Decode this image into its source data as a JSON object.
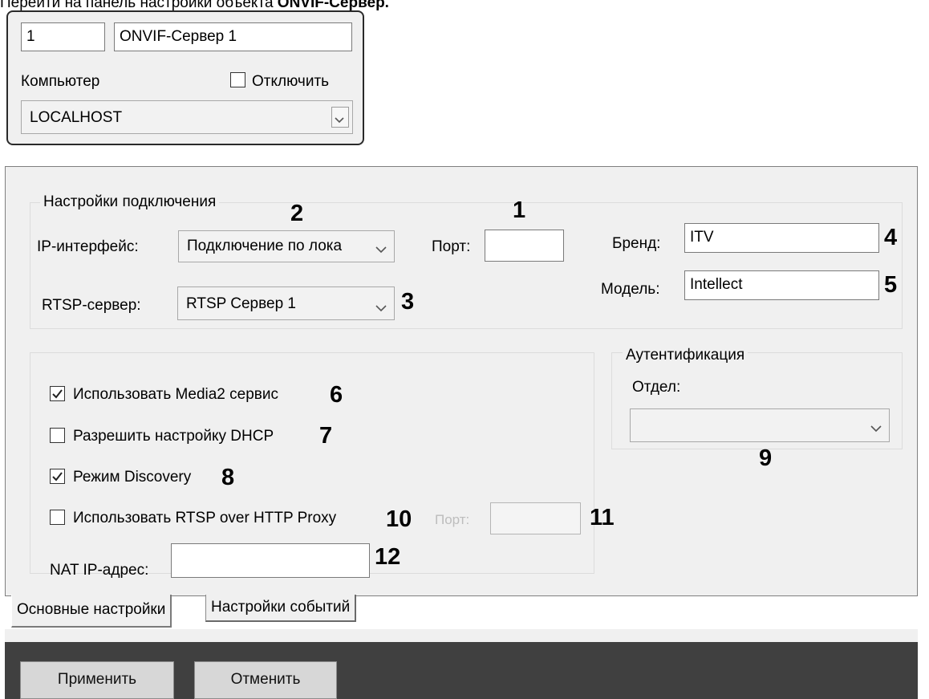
{
  "caption": {
    "prefix": "Перейти на панель настройки объекта ",
    "object": "ONVIF-Сервер."
  },
  "object_panel": {
    "id_value": "1",
    "name_value": "ONVIF-Сервер 1",
    "computer_label": "Компьютер",
    "disable_label": "Отключить",
    "disable_checked": false,
    "computer_value": "LOCALHOST"
  },
  "connection": {
    "group_title": "Настройки подключения",
    "ip_interface_label": "IP-интерфейс:",
    "ip_interface_value": "Подключение по лока",
    "port_label": "Порт:",
    "port_value": "",
    "rtsp_server_label": "RTSP-сервер:",
    "rtsp_server_value": "RTSP Сервер 1",
    "brand_label": "Бренд:",
    "brand_value": "ITV",
    "model_label": "Модель:",
    "model_value": "Intellect"
  },
  "options": {
    "media2": {
      "label": "Использовать Media2 сервис",
      "checked": true
    },
    "dhcp": {
      "label": "Разрешить настройку DHCP",
      "checked": false
    },
    "discovery": {
      "label": "Режим Discovery",
      "checked": true
    },
    "rtsp_proxy": {
      "label": "Использовать RTSP over HTTP Proxy",
      "checked": false
    },
    "proxy_port_label": "Порт:",
    "proxy_port_value": "",
    "nat_label": "NAT IP-адрес:",
    "nat_value": ""
  },
  "auth": {
    "group_title": "Аутентификация",
    "department_label": "Отдел:",
    "department_value": ""
  },
  "markers": {
    "m1": "1",
    "m2": "2",
    "m3": "3",
    "m4": "4",
    "m5": "5",
    "m6": "6",
    "m7": "7",
    "m8": "8",
    "m9": "9",
    "m10": "10",
    "m11": "11",
    "m12": "12"
  },
  "tabs": [
    {
      "label": "Основные настройки",
      "active": true
    },
    {
      "label": "Настройки событий",
      "active": false
    }
  ],
  "buttons": {
    "apply": "Применить",
    "cancel": "Отменить"
  },
  "icons": {
    "checkbox_check": "checkmark-icon",
    "dropdown": "chevron-down-icon"
  }
}
